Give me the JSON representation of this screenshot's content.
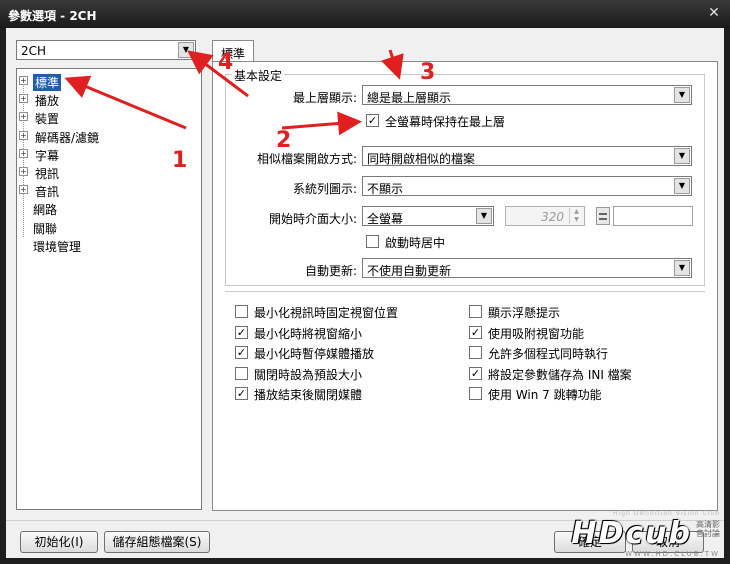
{
  "window": {
    "title": "參數選項 - 2CH",
    "close_glyph": "✕"
  },
  "left": {
    "profile_select": {
      "value": "2CH"
    },
    "tree": [
      {
        "label": "標準",
        "expandable": true,
        "selected": true
      },
      {
        "label": "播放",
        "expandable": true,
        "selected": false
      },
      {
        "label": "裝置",
        "expandable": true,
        "selected": false
      },
      {
        "label": "解碼器/濾鏡",
        "expandable": true,
        "selected": false
      },
      {
        "label": "字幕",
        "expandable": true,
        "selected": false
      },
      {
        "label": "視訊",
        "expandable": true,
        "selected": false
      },
      {
        "label": "音訊",
        "expandable": true,
        "selected": false
      },
      {
        "label": "網路",
        "expandable": false,
        "selected": false
      },
      {
        "label": "關聯",
        "expandable": false,
        "selected": false
      },
      {
        "label": "環境管理",
        "expandable": false,
        "selected": false
      }
    ]
  },
  "tab": {
    "label": "標準"
  },
  "basic": {
    "group_title": "基本設定",
    "topmost_label": "最上層顯示:",
    "topmost_value": "總是最上層顯示",
    "fullscreen_topmost_label": "全螢幕時保持在最上層",
    "fullscreen_topmost_checked": true,
    "similar_label": "相似檔案開啟方式:",
    "similar_value": "同時開啟相似的檔案",
    "systray_label": "系統列圖示:",
    "systray_value": "不顯示",
    "startsize_label": "開始時介面大小:",
    "startsize_value": "全螢幕",
    "startsize_width": "320",
    "center_label": "啟動時居中",
    "center_checked": false,
    "update_label": "自動更新:",
    "update_value": "不使用自動更新"
  },
  "options_left": [
    {
      "label": "最小化視訊時固定視窗位置",
      "checked": false
    },
    {
      "label": "最小化時將視窗縮小",
      "checked": true
    },
    {
      "label": "最小化時暫停媒體播放",
      "checked": true
    },
    {
      "label": "關閉時設為預設大小",
      "checked": false
    },
    {
      "label": "播放結束後關閉媒體",
      "checked": true
    }
  ],
  "options_right": [
    {
      "label": "顯示浮懸提示",
      "checked": false
    },
    {
      "label": "使用吸附視窗功能",
      "checked": true
    },
    {
      "label": "允許多個程式同時執行",
      "checked": false
    },
    {
      "label": "將設定參數儲存為 INI 檔案",
      "checked": true
    },
    {
      "label": "使用 Win 7 跳轉功能",
      "checked": false
    }
  ],
  "buttons": {
    "init": "初始化(I)",
    "save_profile": "儲存組態檔案(S)",
    "ok": "確定",
    "cancel": "取消"
  },
  "annotations": {
    "color": "#e02020",
    "n1": "1",
    "n2": "2",
    "n3": "3",
    "n4": "4"
  },
  "watermark": {
    "tagline": "High Definition Vision Club",
    "logo": "HDcub",
    "url": "WWW.HD.CLUB.TW",
    "side": "高清影音討論"
  },
  "check_glyph": "✓",
  "arrow_glyph": "▼",
  "expand_glyph": "+"
}
